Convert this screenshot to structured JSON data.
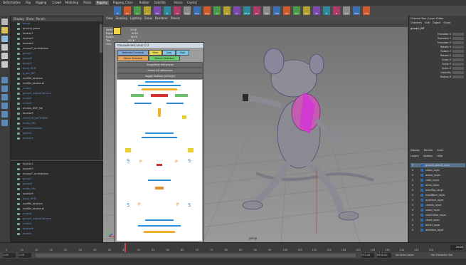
{
  "shelf_tabs": [
    "Deformation",
    "Rig",
    "Rigging",
    "Crowd",
    "Modeling",
    "Poses",
    "Rigging",
    "Rigging_Class",
    "Rubber",
    "Satellite",
    "Shave",
    "Crystal"
  ],
  "shelf_active_index": 6,
  "shelf_buttons": [
    "HI",
    "RFL",
    "Fix",
    "Fix",
    "Text",
    "RI",
    "CB",
    "Snap",
    "Snap",
    "Snap",
    "AP",
    "RI",
    "LIT",
    "SETUP",
    "JNT",
    "MIS",
    "CHN",
    "KEY",
    "EXP",
    "PRT",
    "HIK",
    "IK",
    "IK",
    "UVS",
    "FACE",
    "DYN"
  ],
  "outliner_top": {
    "menu": [
      "Display",
      "Show",
      "Panels"
    ],
    "rows": [
      {
        "label": "persp",
        "style": "blue"
      },
      {
        "label": "ground_plane",
        "style": ""
      },
      {
        "label": "locator1",
        "style": ""
      },
      {
        "label": "locator5",
        "style": ""
      },
      {
        "label": "locator4",
        "style": ""
      },
      {
        "label": "mouse7_animations",
        "style": ""
      },
      {
        "label": "group7",
        "style": "blue"
      },
      {
        "label": "group8",
        "style": "blue"
      },
      {
        "label": "group9",
        "style": "blue"
      },
      {
        "label": "body_HEM",
        "style": "blue"
      },
      {
        "label": "g_prx_HIP",
        "style": "blue"
      },
      {
        "label": "eyeBlk_locators",
        "style": ""
      },
      {
        "label": "eyeBlk_locators1",
        "style": ""
      },
      {
        "label": "nurbs1",
        "style": "blue"
      },
      {
        "label": "group1_adjustCamera",
        "style": "blue"
      },
      {
        "label": "nurbs4",
        "style": "blue"
      },
      {
        "label": "nurbs5",
        "style": "blue"
      },
      {
        "label": "photos_SKP_file",
        "style": ""
      },
      {
        "label": "locator9",
        "style": ""
      },
      {
        "label": "CENSOR_PATTERNS",
        "style": "blue"
      },
      {
        "label": "nurbs_HM",
        "style": "blue"
      },
      {
        "label": "locatorEmotion",
        "style": "blue"
      },
      {
        "label": "jaw1ttr",
        "style": "blue"
      },
      {
        "label": "locator6",
        "style": "blue"
      }
    ]
  },
  "outliner_bottom": {
    "rows": [
      {
        "label": "locator1",
        "style": ""
      },
      {
        "label": "locator5",
        "style": ""
      },
      {
        "label": "mouse7_animations",
        "style": ""
      },
      {
        "label": "group7",
        "style": "blue"
      },
      {
        "label": "group8",
        "style": "blue"
      },
      {
        "label": "nurbs_HM",
        "style": "blue"
      },
      {
        "label": "locator9",
        "style": ""
      },
      {
        "label": "body_HEM",
        "style": "blue"
      },
      {
        "label": "eyeBlk_locators",
        "style": ""
      },
      {
        "label": "eyeBlk_locators1",
        "style": ""
      },
      {
        "label": "nurbs4",
        "style": "blue"
      },
      {
        "label": "group1_adjustCamera",
        "style": "blue"
      },
      {
        "label": "nurbs1",
        "style": "blue"
      },
      {
        "label": "locator6",
        "style": "blue"
      },
      {
        "label": "nurbs5",
        "style": "blue"
      }
    ]
  },
  "viewport": {
    "menu": [
      "View",
      "Shading",
      "Lighting",
      "Show",
      "Renderer",
      "Panels"
    ],
    "hud_labels": [
      "Verts:",
      "Edges:",
      "Faces:",
      "Tris:",
      "UVs:"
    ],
    "hud_values": [
      "0016",
      "0016",
      "0016",
      "0016",
      "0016"
    ],
    "axis_label": "persp"
  },
  "picker": {
    "title": "mouseAnimCursor 0.2",
    "row1": [
      {
        "label": "Selected Controls",
        "bg": "#7fa7d8"
      },
      {
        "label": "Hide",
        "bg": "#e8d95a"
      },
      {
        "label": "Low",
        "bg": "#7cc7e8"
      },
      {
        "label": "High",
        "bg": "#7cc7e8"
      }
    ],
    "row2": [
      {
        "label": "Mirror Selected Controls",
        "bg": "#e8a35a"
      },
      {
        "label": "Select Selected Controls",
        "bg": "#6cc96c"
      }
    ],
    "bars": [
      "Show/Hide Influences",
      "Select All Influences",
      "Toggle Buttons Joints(tt)"
    ],
    "letters": {
      "S": "S",
      "P": "P"
    }
  },
  "channel_box": {
    "menu": [
      "Channels",
      "Edit",
      "Object",
      "Show"
    ],
    "title": "Channel Box / Layer Editor",
    "object": "group1_JNT",
    "channels": [
      "Translate X",
      "Translate Y",
      "Translate Z",
      "Rotate X",
      "Rotate Y",
      "Rotate Z",
      "Scale X",
      "Scale Y",
      "Scale Z",
      "Visibility",
      "Radius B"
    ]
  },
  "layers_panel": {
    "tabs": [
      "Display",
      "Render",
      "Anim"
    ],
    "menu": [
      "Layers",
      "Options",
      "Help"
    ],
    "layers": [
      {
        "v": "V",
        "name": "ground_plane_layer",
        "sel": true
      },
      {
        "v": "V",
        "name": "claws_layer",
        "sel": false
      },
      {
        "v": "V",
        "name": "waistr_layer",
        "sel": false
      },
      {
        "v": "V",
        "name": "cloth_layer",
        "sel": false
      },
      {
        "v": "V",
        "name": "arms_layer",
        "sel": false
      },
      {
        "v": "V",
        "name": "headTop_layer",
        "sel": false
      },
      {
        "v": "V",
        "name": "headBack_layer",
        "sel": false
      },
      {
        "v": "V",
        "name": "eyebrow_layer",
        "sel": false
      },
      {
        "v": "V",
        "name": "cheeks_layer",
        "sel": false
      },
      {
        "v": "V",
        "name": "snout_layer",
        "sel": false
      },
      {
        "v": "V",
        "name": "neckCollar_layer",
        "sel": false
      },
      {
        "v": "V",
        "name": "chest_layer",
        "sel": false
      },
      {
        "v": "V",
        "name": "pelvis_layer",
        "sel": false
      },
      {
        "v": "V",
        "name": "whiskers_layer",
        "sel": false
      }
    ]
  },
  "timeline": {
    "ticks": [
      "5",
      "10",
      "15",
      "20",
      "25",
      "30",
      "35",
      "40",
      "45",
      "50",
      "55",
      "60",
      "65",
      "70",
      "75",
      "80",
      "85",
      "90",
      "95",
      "100",
      "105",
      "110",
      "115",
      "120",
      "125",
      "130",
      "135",
      "140",
      "145",
      "150"
    ],
    "current_frame": "29.00"
  },
  "range": {
    "start": "1.00",
    "start2": "1.00",
    "end": "275.00",
    "end2": "6150.00",
    "anim_layer": "No Anim Layer",
    "char_set": "No Character Set"
  },
  "colors": {
    "accent": "#5a6f8c",
    "magenta": "#d23bd2"
  }
}
